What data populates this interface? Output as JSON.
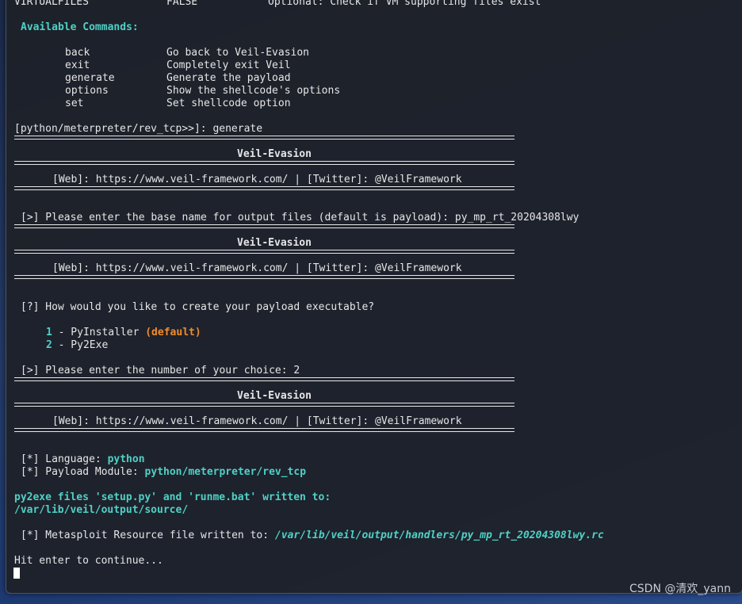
{
  "terminal": {
    "option_row": {
      "name": "VIRTUALFILES",
      "value": "FALSE",
      "description": "Optional: Check if VM supporting files exist"
    },
    "commands_header": "Available Commands:",
    "commands": [
      {
        "cmd": "back",
        "desc": "Go back to Veil-Evasion"
      },
      {
        "cmd": "exit",
        "desc": "Completely exit Veil"
      },
      {
        "cmd": "generate",
        "desc": "Generate the payload"
      },
      {
        "cmd": "options",
        "desc": "Show the shellcode's options"
      },
      {
        "cmd": "set",
        "desc": "Set shellcode option"
      }
    ],
    "prompt": "[python/meterpreter/rev_tcp>>]: generate",
    "banner_title": "Veil-Evasion",
    "banner_web": "[Web]: https://www.veil-framework.com/ | [Twitter]: @VeilFramework",
    "base_name_prompt": "[>] Please enter the base name for output files (default is payload): py_mp_rt_20204308lwy",
    "executable_question": "[?] How would you like to create your payload executable?",
    "choices": [
      {
        "num": "1",
        "label": " - PyInstaller ",
        "tag": "(default)"
      },
      {
        "num": "2",
        "label": " - Py2Exe",
        "tag": ""
      }
    ],
    "choice_prompt": "[>] Please enter the number of your choice: 2",
    "language_label": "[*] Language: ",
    "language_value": "python",
    "module_label": "[*] Payload Module: ",
    "module_value": "python/meterpreter/rev_tcp",
    "py2exe_line1": "py2exe files 'setup.py' and 'runme.bat' written to:",
    "py2exe_line2": "/var/lib/veil/output/source/",
    "resource_label": "[*] Metasploit Resource file written to: ",
    "resource_value": "/var/lib/veil/output/handlers/py_mp_rt_20204308lwy.rc",
    "continue": "Hit enter to continue..."
  },
  "watermark": "CSDN @清欢_yann",
  "colors": {
    "accent": "#4fd1c5",
    "highlight": "#f28c28",
    "text": "#e6e6e6",
    "background": "#1e2128"
  }
}
